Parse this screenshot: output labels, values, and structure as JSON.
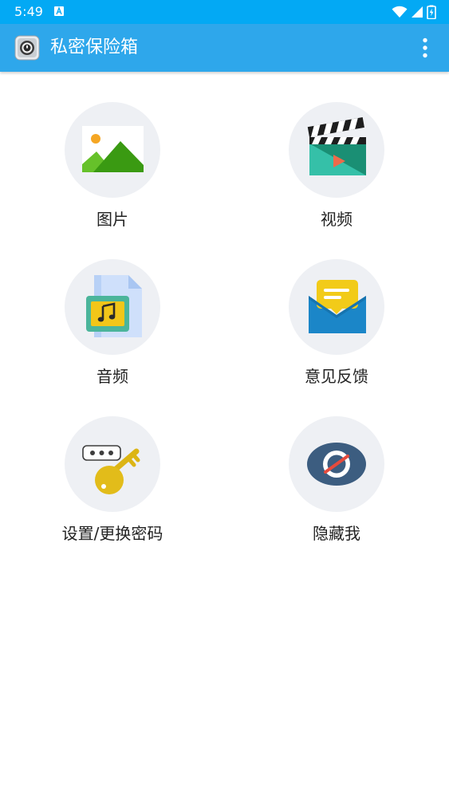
{
  "status_bar": {
    "time": "5:49"
  },
  "app_bar": {
    "title": "私密保险箱"
  },
  "grid": {
    "items": [
      {
        "label": "图片",
        "icon": "image-icon"
      },
      {
        "label": "视频",
        "icon": "video-clapperboard-icon"
      },
      {
        "label": "音频",
        "icon": "audio-file-icon"
      },
      {
        "label": "意见反馈",
        "icon": "feedback-envelope-icon"
      },
      {
        "label": "设置/更换密码",
        "icon": "password-key-icon"
      },
      {
        "label": "隐藏我",
        "icon": "hide-eye-icon"
      }
    ]
  },
  "colors": {
    "status_bar": "#03a9f4",
    "app_bar": "#2ea7eb",
    "circle_bg": "#eef0f4"
  }
}
